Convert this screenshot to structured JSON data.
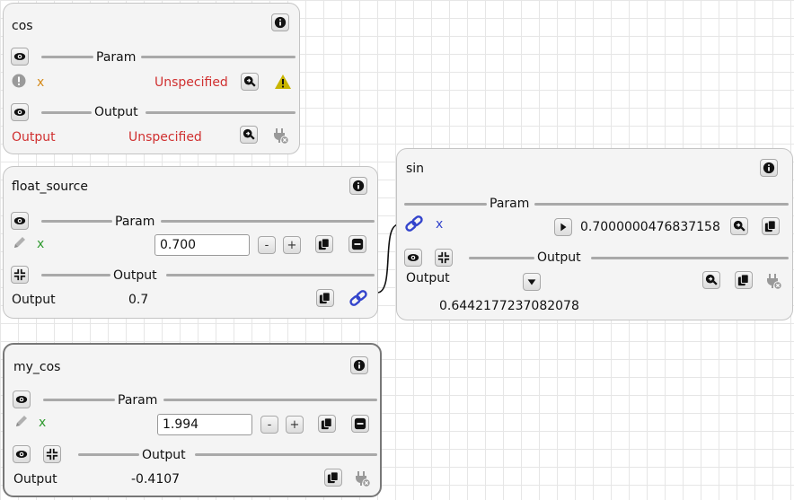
{
  "nodes": {
    "cos": {
      "title": "cos",
      "param_header": "Param",
      "param_name": "x",
      "param_value": "Unspecified",
      "output_header": "Output",
      "output_name": "Output",
      "output_value": "Unspecified"
    },
    "float_source": {
      "title": "float_source",
      "param_header": "Param",
      "param_name": "x",
      "param_value": "0.700",
      "minus_label": "-",
      "plus_label": "+",
      "output_header": "Output",
      "output_name": "Output",
      "output_value": "0.7"
    },
    "sin": {
      "title": "sin",
      "param_header": "Param",
      "param_name": "x",
      "param_value": "0.7000000476837158",
      "output_header": "Output",
      "output_name": "Output",
      "output_value": "0.6442177237082078"
    },
    "my_cos": {
      "title": "my_cos",
      "param_header": "Param",
      "param_name": "x",
      "param_value": "1.994",
      "minus_label": "-",
      "plus_label": "+",
      "output_header": "Output",
      "output_name": "Output",
      "output_value": "-0.4107"
    }
  },
  "colors": {
    "unspecified": "#d03030",
    "param_warning": "#d58a1a",
    "param_editable": "#2f9a2f",
    "param_linked": "#3344cc",
    "warning_icon": "#c8b400"
  },
  "icons": [
    "info-icon",
    "eye-icon",
    "zoom-in-icon",
    "warning-icon",
    "unplug-icon",
    "copy-icon",
    "minus-square-icon",
    "collapse-icon",
    "link-icon",
    "pencil-icon",
    "alert-circle-icon",
    "play-icon",
    "dropdown-icon"
  ]
}
